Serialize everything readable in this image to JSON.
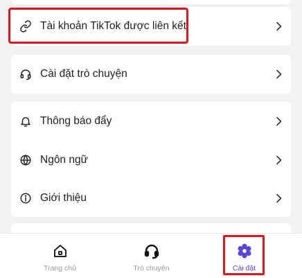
{
  "settings": {
    "linked_tiktok": "Tài khoản TikTok được liên kết",
    "chat_settings": "Cài đặt trò chuyện",
    "push_notifications": "Thông báo đẩy",
    "language": "Ngôn ngữ",
    "about": "Giới thiệu"
  },
  "icons": {
    "link": "link-icon",
    "chat_settings": "headset-icon",
    "notifications": "bell-icon",
    "language": "globe-icon",
    "about": "info-icon",
    "chevron": "chevron-right-icon",
    "home": "home-icon",
    "chat": "headset-icon",
    "settings": "gear-icon"
  },
  "bottom_nav": {
    "items": [
      {
        "label": "Trang chủ",
        "active": false
      },
      {
        "label": "Trò chuyện",
        "active": false
      },
      {
        "label": "Cài đặt",
        "active": true
      }
    ]
  },
  "colors": {
    "accent": "#5b43d6",
    "highlight": "#e0141c",
    "background": "#f2f2f4",
    "inactive_nav": "#9a9aa0"
  }
}
